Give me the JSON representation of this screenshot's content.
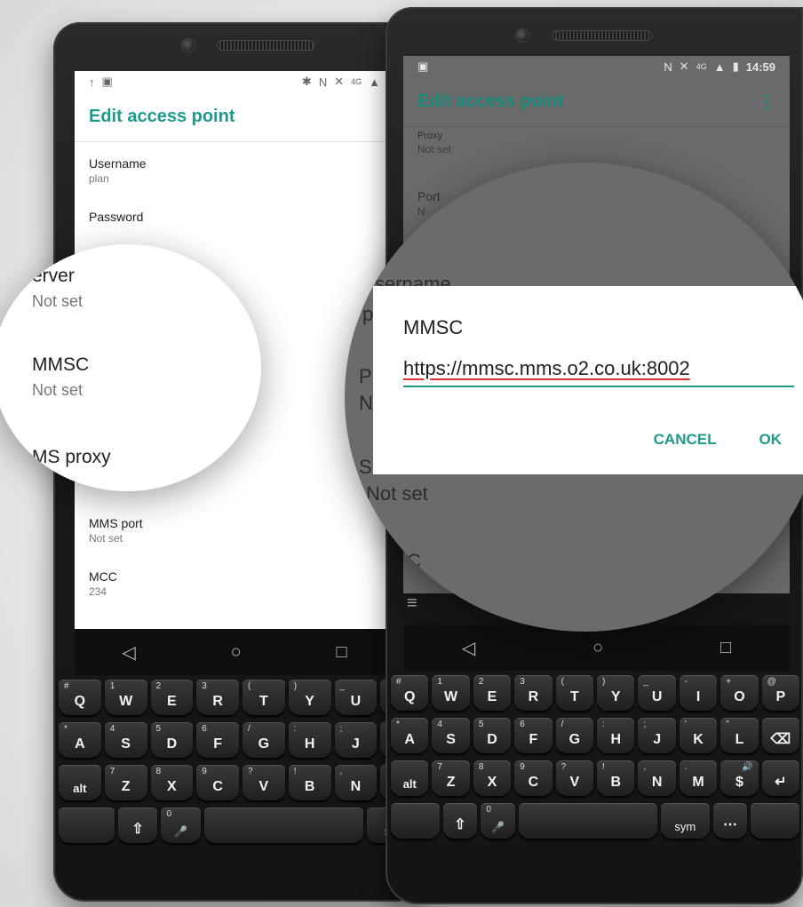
{
  "left_phone": {
    "status_icons": [
      "↑",
      "▣",
      "✱",
      "N",
      "✕",
      "4G",
      "▲"
    ],
    "app_title": "Edit access point",
    "prefs": [
      {
        "title": "Username",
        "summary": "plan"
      },
      {
        "title": "Password",
        "summary": ""
      },
      {
        "title": "MMS port",
        "summary": "Not set"
      },
      {
        "title": "MCC",
        "summary": "234"
      }
    ],
    "nav": [
      "◁",
      "○",
      "□"
    ]
  },
  "left_magnifier": {
    "items": [
      {
        "title": "erver",
        "summary": "Not set"
      },
      {
        "title": "MMSC",
        "summary": "Not set"
      },
      {
        "title": "MS proxy",
        "summary": ""
      }
    ]
  },
  "right_phone": {
    "time": "14:59",
    "status_icons": [
      "N",
      "✕",
      "4G",
      "▲",
      "▮"
    ],
    "app_title": "Edit access point",
    "overflow_icon": "⋮",
    "prefs": [
      {
        "title": "Proxy",
        "summary": "Not set"
      },
      {
        "title": "Port",
        "summary": "N"
      }
    ],
    "nav": [
      "◁",
      "○",
      "□"
    ],
    "menu_icon": "≡"
  },
  "right_magnifier": {
    "bg_texts": [
      "sername",
      "pl",
      "P",
      "N",
      "S",
      "Not set",
      "C"
    ]
  },
  "dialog": {
    "title": "MMSC",
    "value": "https://mmsc.mms.o2.co.uk:8002",
    "cancel_label": "CANCEL",
    "ok_label": "OK"
  },
  "keyboard": {
    "row1": [
      {
        "main": "Q",
        "alt": "#"
      },
      {
        "main": "W",
        "alt": "1"
      },
      {
        "main": "E",
        "alt": "2"
      },
      {
        "main": "R",
        "alt": "3"
      },
      {
        "main": "T",
        "alt": "("
      },
      {
        "main": "Y",
        "alt": ")"
      },
      {
        "main": "U",
        "alt": "_"
      },
      {
        "main": "I",
        "alt": "-"
      },
      {
        "main": "O",
        "alt": "+"
      },
      {
        "main": "P",
        "alt": "@"
      }
    ],
    "row2": [
      {
        "main": "A",
        "alt": "*"
      },
      {
        "main": "S",
        "alt": "4"
      },
      {
        "main": "D",
        "alt": "5"
      },
      {
        "main": "F",
        "alt": "6"
      },
      {
        "main": "G",
        "alt": "/"
      },
      {
        "main": "H",
        "alt": ":"
      },
      {
        "main": "J",
        "alt": ";"
      },
      {
        "main": "K",
        "alt": "'"
      },
      {
        "main": "L",
        "alt": "\""
      },
      {
        "main": "⌫",
        "alt": ""
      }
    ],
    "row3": [
      {
        "main": "alt",
        "alt": ""
      },
      {
        "main": "Z",
        "alt": "7"
      },
      {
        "main": "X",
        "alt": "8"
      },
      {
        "main": "C",
        "alt": "9"
      },
      {
        "main": "V",
        "alt": "?"
      },
      {
        "main": "B",
        "alt": "!"
      },
      {
        "main": "N",
        "alt": ","
      },
      {
        "main": "M",
        "alt": "."
      },
      {
        "main": "$",
        "alt": "🔊"
      },
      {
        "main": "↵",
        "alt": ""
      }
    ],
    "row4": [
      {
        "main": "⇧",
        "alt": ""
      },
      {
        "main": "🎤",
        "alt": "0"
      },
      {
        "main": "",
        "alt": ""
      },
      {
        "main": "sym",
        "alt": ""
      },
      {
        "main": "⋯",
        "alt": ""
      }
    ]
  }
}
